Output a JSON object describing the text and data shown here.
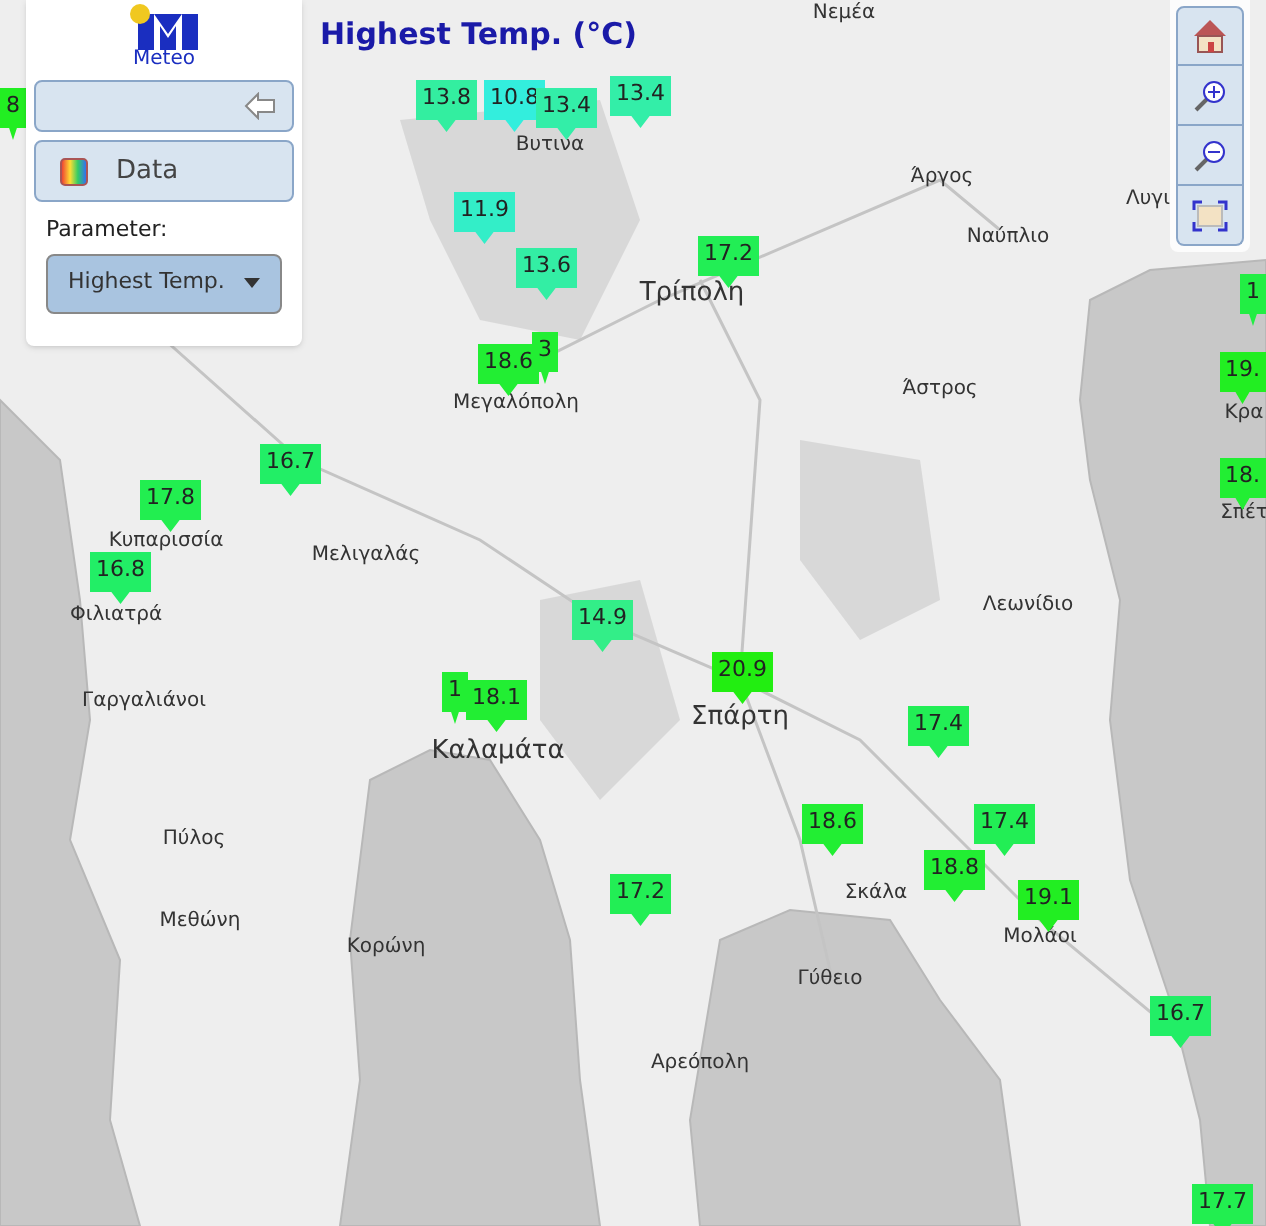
{
  "logo": {
    "text": "Meteo"
  },
  "map_title": "Highest Temp. (°C)",
  "side_panel": {
    "data_button": "Data",
    "parameter_label": "Parameter:",
    "parameter_select": {
      "value": "Highest Temp."
    }
  },
  "place_labels": [
    {
      "text": "Νεμέα",
      "kind": "town"
    },
    {
      "text": "Άργος",
      "kind": "town"
    },
    {
      "text": "Λυγι",
      "kind": "town"
    },
    {
      "text": "Ναύπλιο",
      "kind": "town"
    },
    {
      "text": "Βυτινα",
      "kind": "town"
    },
    {
      "text": "Τρίπολη",
      "kind": "city"
    },
    {
      "text": "Μεγαλόπολη",
      "kind": "town"
    },
    {
      "text": "Κρα",
      "kind": "town"
    },
    {
      "text": "Άστρος",
      "kind": "town"
    },
    {
      "text": "Σπέτ",
      "kind": "town"
    },
    {
      "text": "Κυπαρισσία",
      "kind": "town"
    },
    {
      "text": "Μελιγαλάς",
      "kind": "town"
    },
    {
      "text": "Φιλιατρά",
      "kind": "town"
    },
    {
      "text": "Λεωνίδιο",
      "kind": "town"
    },
    {
      "text": "Γαργαλιάνοι",
      "kind": "town"
    },
    {
      "text": "Καλαμάτα",
      "kind": "city"
    },
    {
      "text": "Σπάρτη",
      "kind": "city"
    },
    {
      "text": "Πύλος",
      "kind": "town"
    },
    {
      "text": "Μεθώνη",
      "kind": "town"
    },
    {
      "text": "Κορώνη",
      "kind": "town"
    },
    {
      "text": "Σκάλα",
      "kind": "town"
    },
    {
      "text": "Μολάοι",
      "kind": "town"
    },
    {
      "text": "Γύθειο",
      "kind": "town"
    },
    {
      "text": "Αρεόπολη",
      "kind": "town"
    }
  ],
  "markers": [
    {
      "value": "8",
      "color": "#22ee22"
    },
    {
      "value": "13.8",
      "color": "#33eea0"
    },
    {
      "value": "10.8",
      "color": "#33eedd"
    },
    {
      "value": "13.4",
      "color": "#33eea8"
    },
    {
      "value": "13.4",
      "color": "#33eea8"
    },
    {
      "value": "11.9",
      "color": "#33eec8"
    },
    {
      "value": "13.6",
      "color": "#33eea4"
    },
    {
      "value": "17.2",
      "color": "#22ee55"
    },
    {
      "value": "3",
      "color": "#22ee33"
    },
    {
      "value": "18.6",
      "color": "#22ee33"
    },
    {
      "value": "1",
      "color": "#22ee44"
    },
    {
      "value": "19.",
      "color": "#22ee22"
    },
    {
      "value": "18.",
      "color": "#22ee33"
    },
    {
      "value": "16.7",
      "color": "#22ee66"
    },
    {
      "value": "17.8",
      "color": "#22ee50"
    },
    {
      "value": "16.8",
      "color": "#22ee66"
    },
    {
      "value": "14.9",
      "color": "#33ee88"
    },
    {
      "value": "1",
      "color": "#22ee33"
    },
    {
      "value": "18.1",
      "color": "#22ee33"
    },
    {
      "value": "20.9",
      "color": "#22ee11"
    },
    {
      "value": "17.4",
      "color": "#22ee55"
    },
    {
      "value": "18.6",
      "color": "#22ee33"
    },
    {
      "value": "17.4",
      "color": "#22ee55"
    },
    {
      "value": "18.8",
      "color": "#22ee33"
    },
    {
      "value": "19.1",
      "color": "#22ee22"
    },
    {
      "value": "16.7",
      "color": "#22ee66"
    },
    {
      "value": "17.2",
      "color": "#22ee55"
    },
    {
      "value": "17.7",
      "color": "#22ee50"
    }
  ]
}
